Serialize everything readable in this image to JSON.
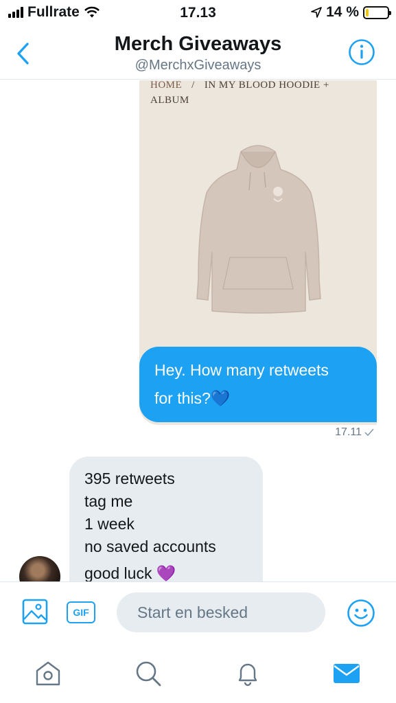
{
  "status_bar": {
    "carrier": "Fullrate",
    "time": "17.13",
    "battery_percent": "14 %",
    "battery_level": 0.14,
    "battery_color": "#f5c400"
  },
  "header": {
    "title": "Merch Giveaways",
    "handle": "@MerchxGiveaways",
    "back_icon": "chevron-left-icon",
    "info_icon": "info-icon"
  },
  "conversation": {
    "shared_image": {
      "breadcrumb_home": "HOME",
      "breadcrumb_separator": "/",
      "breadcrumb_item_line1": "IN MY BLOOD HOODIE +",
      "breadcrumb_item_line2": "ALBUM"
    },
    "outgoing_message": {
      "text_line1": "Hey. How many retweets",
      "text_line2": "for this?💙",
      "timestamp": "17.11",
      "read_receipt_icon": "check-icon"
    },
    "incoming_message": {
      "lines": [
        "395 retweets",
        "tag me",
        "1 week",
        "no saved accounts",
        "good luck 💜"
      ]
    }
  },
  "composer": {
    "placeholder": "Start en besked",
    "gif_label": "GIF",
    "media_icon": "image-icon",
    "emoji_icon": "smiley-icon"
  },
  "tab_bar": {
    "tabs": [
      "home-icon",
      "search-icon",
      "notifications-icon",
      "messages-icon"
    ],
    "active_tab": "messages-icon"
  },
  "colors": {
    "accent": "#1da1f2",
    "incoming_bubble": "#e6ecf0",
    "secondary_text": "#657786"
  }
}
